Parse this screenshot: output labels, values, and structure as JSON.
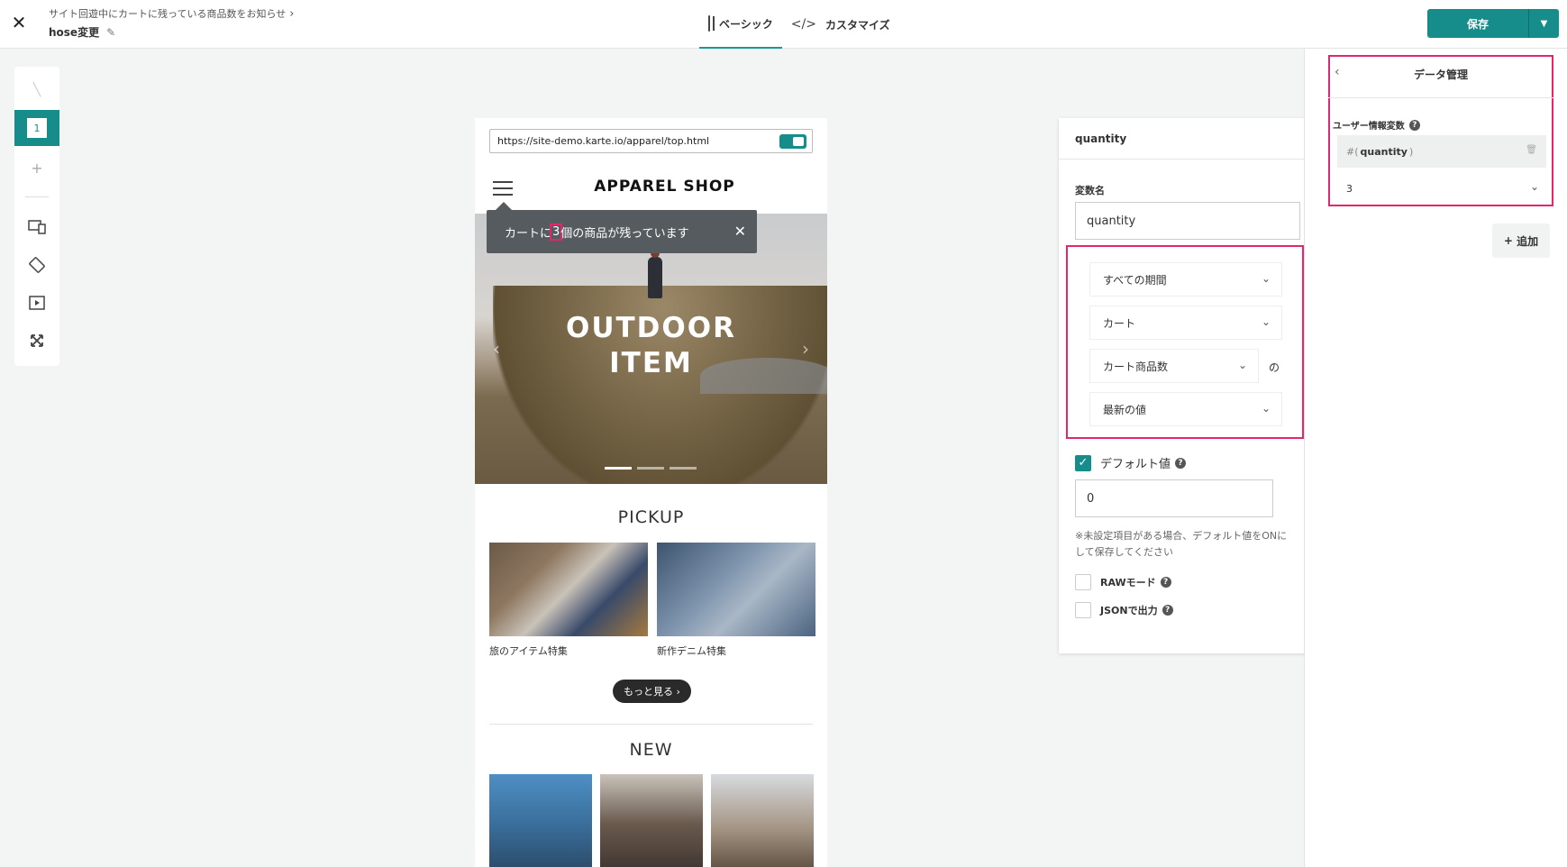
{
  "header": {
    "breadcrumb": "サイト回遊中にカートに残っている商品数をお知らせ",
    "campaign_name": "hose変更",
    "tabs": [
      {
        "label": "ベーシック",
        "icon": "panel-icon"
      },
      {
        "label": "カスタマイズ",
        "icon": "code-icon"
      }
    ],
    "save_label": "保存"
  },
  "rail": {
    "active_step": "1"
  },
  "preview": {
    "url": "https://site-demo.karte.io/apparel/top.html",
    "shop_title": "APPAREL SHOP",
    "toast": {
      "prefix": "カートに",
      "count": "3",
      "suffix": "個の商品が残っています"
    },
    "hero_line1": "OUTDOOR",
    "hero_line2": "ITEM",
    "pickup_title": "PICKUP",
    "pickup_items": [
      "旅のアイテム特集",
      "新作デニム特集"
    ],
    "more_label": "もっと見る",
    "new_title": "NEW"
  },
  "variable_editor": {
    "title": "quantity",
    "name_label": "変数名",
    "name_value": "quantity",
    "period": "すべての期間",
    "category": "カート",
    "field": "カート商品数",
    "no_particle": "の",
    "aggregation": "最新の値",
    "default_label": "デフォルト値",
    "default_checked": true,
    "default_value": "0",
    "note": "※未設定項目がある場合、デフォルト値をONにして保存してください",
    "raw_mode_label": "RAWモード",
    "json_output_label": "JSONで出力"
  },
  "data_panel": {
    "title": "データ管理",
    "section_label": "ユーザー情報変数",
    "variable_prefix": "#(",
    "variable_name": "quantity",
    "variable_suffix": ")",
    "value": "3",
    "add_label": "追加"
  },
  "colors": {
    "accent": "#168d8a",
    "highlight": "#e0286e"
  }
}
